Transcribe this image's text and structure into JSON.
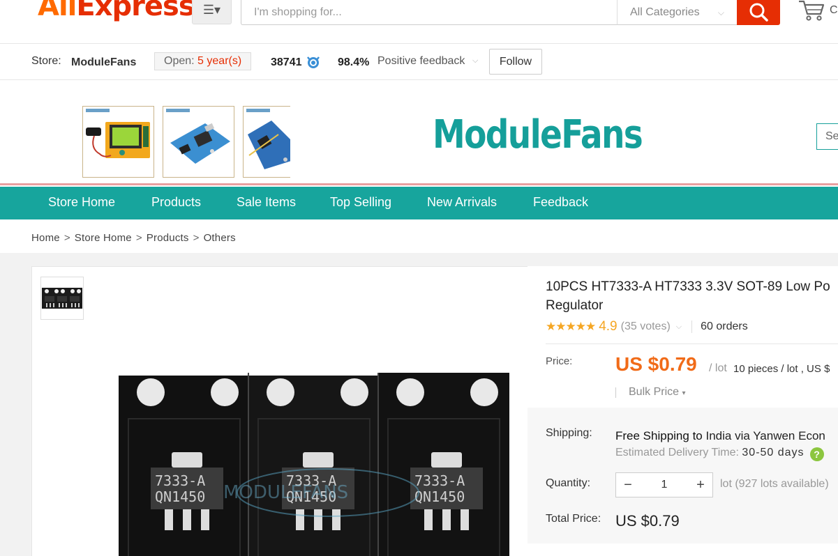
{
  "header": {
    "logo_ali": "Ali",
    "logo_express": "Express",
    "search_placeholder": "I'm shopping for...",
    "category": "All Categories",
    "cart_extra": "C"
  },
  "store": {
    "label": "Store:",
    "name": "ModuleFans",
    "open_label": "Open:",
    "open_years": "5 year(s)",
    "score": "38741",
    "feedback_pct": "98.4%",
    "feedback_label": "Positive feedback",
    "follow_label": "Follow"
  },
  "banner": {
    "title": "ModuleFans",
    "search_text": "Se"
  },
  "nav": {
    "items": [
      "Store Home",
      "Products",
      "Sale Items",
      "Top Selling",
      "New Arrivals",
      "Feedback"
    ]
  },
  "breadcrumb": {
    "items": [
      "Home",
      "Store Home",
      "Products",
      "Others"
    ],
    "separator": ">"
  },
  "product": {
    "title_line1": "10PCS HT7333-A HT7333 3.3V SOT-89 Low Po",
    "title_line2": "Regulator",
    "stars": "★★★★★",
    "rating": "4.9",
    "votes": "(35 votes)",
    "orders": "60 orders",
    "price_label": "Price:",
    "price": "US $0.79",
    "price_unit": "/ lot",
    "price_extra": "10 pieces / lot , US $",
    "bulk_label": "Bulk Price",
    "chip_markings": [
      "7333-A",
      "QN1450"
    ],
    "watermark": "MODULEFANS"
  },
  "shipping": {
    "label": "Shipping:",
    "free_text": "Free Shipping to",
    "destination": "India via Yanwen Econ",
    "est_label": "Estimated Delivery Time:",
    "est_days": "30-50 days"
  },
  "quantity": {
    "label": "Quantity:",
    "value": "1",
    "available": "lot (927 lots available)"
  },
  "total": {
    "label": "Total Price:",
    "value": "US $0.79"
  },
  "colors": {
    "brand_orange": "#ff6a00",
    "brand_red": "#e62e04",
    "store_teal": "#17a59d",
    "price_orange": "#f16b18"
  }
}
